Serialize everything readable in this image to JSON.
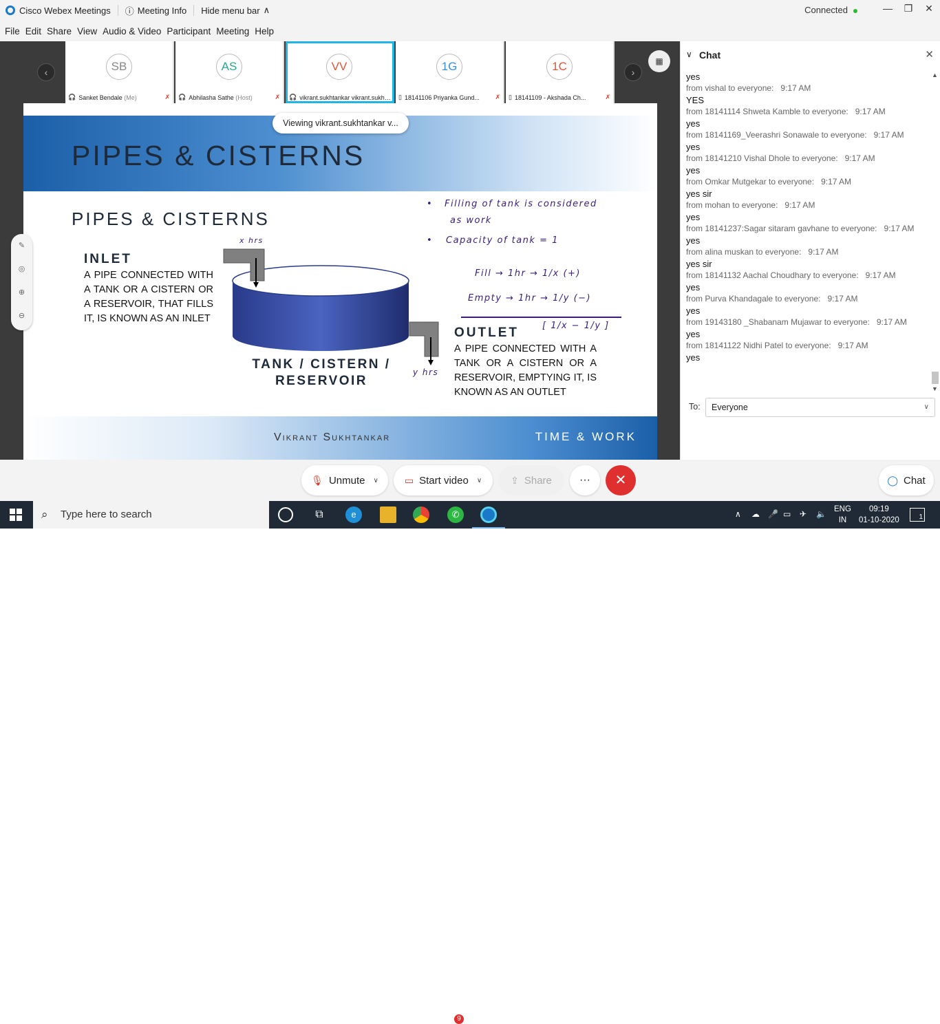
{
  "titlebar": {
    "app_name": "Cisco Webex Meetings",
    "meeting_info": "Meeting Info",
    "hide_menu": "Hide menu bar",
    "status": "Connected"
  },
  "menu": [
    "File",
    "Edit",
    "Share",
    "View",
    "Audio & Video",
    "Participant",
    "Meeting",
    "Help"
  ],
  "participants": [
    {
      "initials": "SB",
      "name": "Sanket Bendale",
      "suffix": "(Me)",
      "color": "#888"
    },
    {
      "initials": "AS",
      "name": "Abhilasha Sathe",
      "suffix": "(Host)",
      "color": "#2aa88f"
    },
    {
      "initials": "VV",
      "name": "vikrant.sukhtankar vikrant.sukhta...",
      "suffix": "",
      "color": "#e0553a"
    },
    {
      "initials": "1G",
      "name": "18141106 Priyanka Gund...",
      "suffix": "",
      "color": "#3b8ed8"
    },
    {
      "initials": "1C",
      "name": "18141109 - Akshada Ch...",
      "suffix": "",
      "color": "#e0553a"
    }
  ],
  "viewing_label": "Viewing vikrant.sukhtankar v...",
  "slide": {
    "title": "PIPES & CISTERNS",
    "subtitle": "PIPES & CISTERNS",
    "inlet_title": "INLET",
    "inlet_text": "A PIPE CONNECTED WITH A TANK OR A CISTERN OR A RESERVOIR, THAT FILLS IT, IS KNOWN AS AN INLET",
    "tank_label": "TANK / CISTERN / RESERVOIR",
    "outlet_title": "OUTLET",
    "outlet_text": "A PIPE CONNECTED WITH A TANK OR A CISTERN OR A RESERVOIR, EMPTYING IT, IS KNOWN AS AN OUTLET",
    "footer_author": "Vikrant Sukhtankar",
    "footer_topic": "TIME & WORK",
    "notes": {
      "n1a": "Filling of tank is considered",
      "n1b": "as work",
      "n2": "Capacity of tank = 1",
      "fill": "Fill → 1hr → 1/x (+)",
      "empty": "Empty → 1hr → 1/y (−)",
      "diff": "[ 1/x − 1/y ]",
      "xhrs": "x hrs",
      "yhrs": "y hrs"
    }
  },
  "chat": {
    "title": "Chat",
    "messages": [
      {
        "body": "yes",
        "from": "from vishal to everyone:",
        "time": "9:17 AM"
      },
      {
        "body": "YES",
        "from": "from 18141114 Shweta Kamble to everyone:",
        "time": "9:17 AM"
      },
      {
        "body": "yes",
        "from": "from 18141169_Veerashri Sonawale to everyone:",
        "time": "9:17 AM"
      },
      {
        "body": "yes",
        "from": "from 18141210 Vishal Dhole to everyone:",
        "time": "9:17 AM"
      },
      {
        "body": "yes",
        "from": "from Omkar Mutgekar to everyone:",
        "time": "9:17 AM"
      },
      {
        "body": "yes sir",
        "from": "from mohan to everyone:",
        "time": "9:17 AM"
      },
      {
        "body": "yes",
        "from": "from 18141237:Sagar sitaram gavhane to everyone:",
        "time": "9:17 AM"
      },
      {
        "body": "yes",
        "from": "from alina muskan to everyone:",
        "time": "9:17 AM"
      },
      {
        "body": "yes sir",
        "from": "from 18141132 Aachal Choudhary to everyone:",
        "time": "9:17 AM"
      },
      {
        "body": "yes",
        "from": "from Purva Khandagale to everyone:",
        "time": "9:17 AM"
      },
      {
        "body": "yes",
        "from": "from 19143180 _Shabanam Mujawar to everyone:",
        "time": "9:17 AM"
      },
      {
        "body": "yes",
        "from": "from 18141122 Nidhi Patel to everyone:",
        "time": "9:17 AM"
      },
      {
        "body": "yes",
        "from": "",
        "time": ""
      }
    ],
    "to_label": "To:",
    "to_value": "Everyone"
  },
  "controls": {
    "unmute": "Unmute",
    "start_video": "Start video",
    "share": "Share",
    "more": "···",
    "chat": "Chat"
  },
  "taskbar": {
    "search_placeholder": "Type here to search",
    "lang1": "ENG",
    "lang2": "IN",
    "time": "09:19",
    "date": "01-10-2020",
    "whatsapp_badge": "9",
    "notif_count": "1"
  }
}
